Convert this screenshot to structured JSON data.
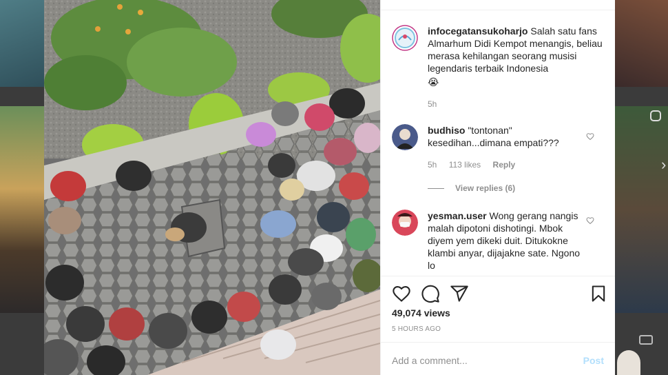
{
  "post": {
    "caption": {
      "username": "infocegatansukoharjo",
      "text": "Salah satu fans Almarhum Didi Kempot menangis, beliau merasa kehilangan seorang musisi legendaris terbaik Indonesia",
      "emoji": "😭",
      "age": "5h"
    },
    "comments": [
      {
        "username": "budhiso",
        "text": "\"tontonan\" kesedihan...dimana empati???",
        "age": "5h",
        "likes": "113 likes",
        "reply_label": "Reply"
      },
      {
        "username": "yesman.user",
        "text": "Wong gerang nangis malah dipotoni dishotingi. Mbok diyem yem dikeki duit. Ditukokne klambi anyar, dijajakne sate. Ngono lo"
      }
    ],
    "view_replies": "View replies (6)",
    "views": "49,074 views",
    "posted": "5 HOURS AGO",
    "add_comment_placeholder": "Add a comment...",
    "post_label": "Post"
  },
  "icons": {
    "like": "heart-icon",
    "comment": "comment-icon",
    "share": "share-icon",
    "save": "bookmark-icon"
  },
  "colors": {
    "text": "#262626",
    "muted": "#8e8e8e",
    "post_disabled": "#b2dffc"
  }
}
